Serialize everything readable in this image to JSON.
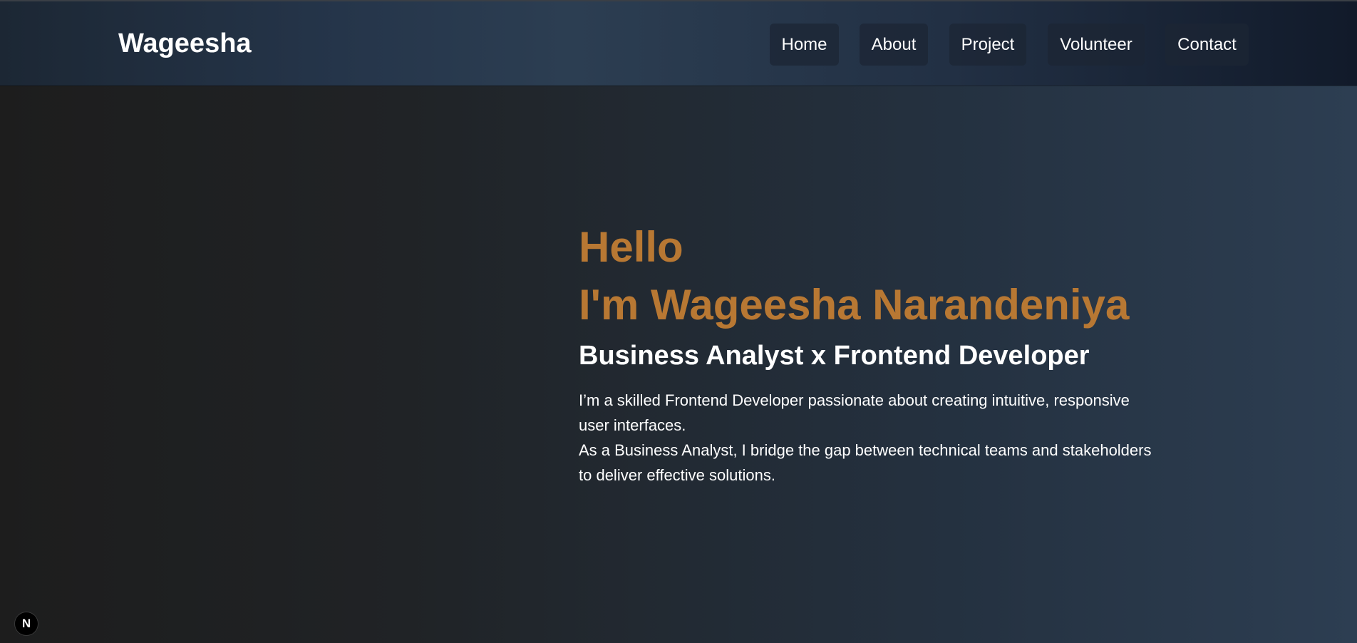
{
  "header": {
    "brand": "Wageesha",
    "nav": [
      {
        "label": "Home"
      },
      {
        "label": "About"
      },
      {
        "label": "Project"
      },
      {
        "label": "Volunteer"
      },
      {
        "label": "Contact"
      }
    ]
  },
  "hero": {
    "greeting": "Hello",
    "name": "I'm Wageesha Narandeniya",
    "role": "Business Analyst x Frontend Developer",
    "description": [
      "I’m a skilled Frontend Developer passionate about creating intuitive, responsive user interfaces.",
      "As a Business Analyst, I bridge the gap between technical teams and stakeholders to deliver effective solutions."
    ]
  },
  "dev_indicator": {
    "label": "N",
    "icon": "nextjs-icon"
  },
  "colors": {
    "accent": "#b87833",
    "text": "#ffffff",
    "nav_bg": "#25354a"
  }
}
